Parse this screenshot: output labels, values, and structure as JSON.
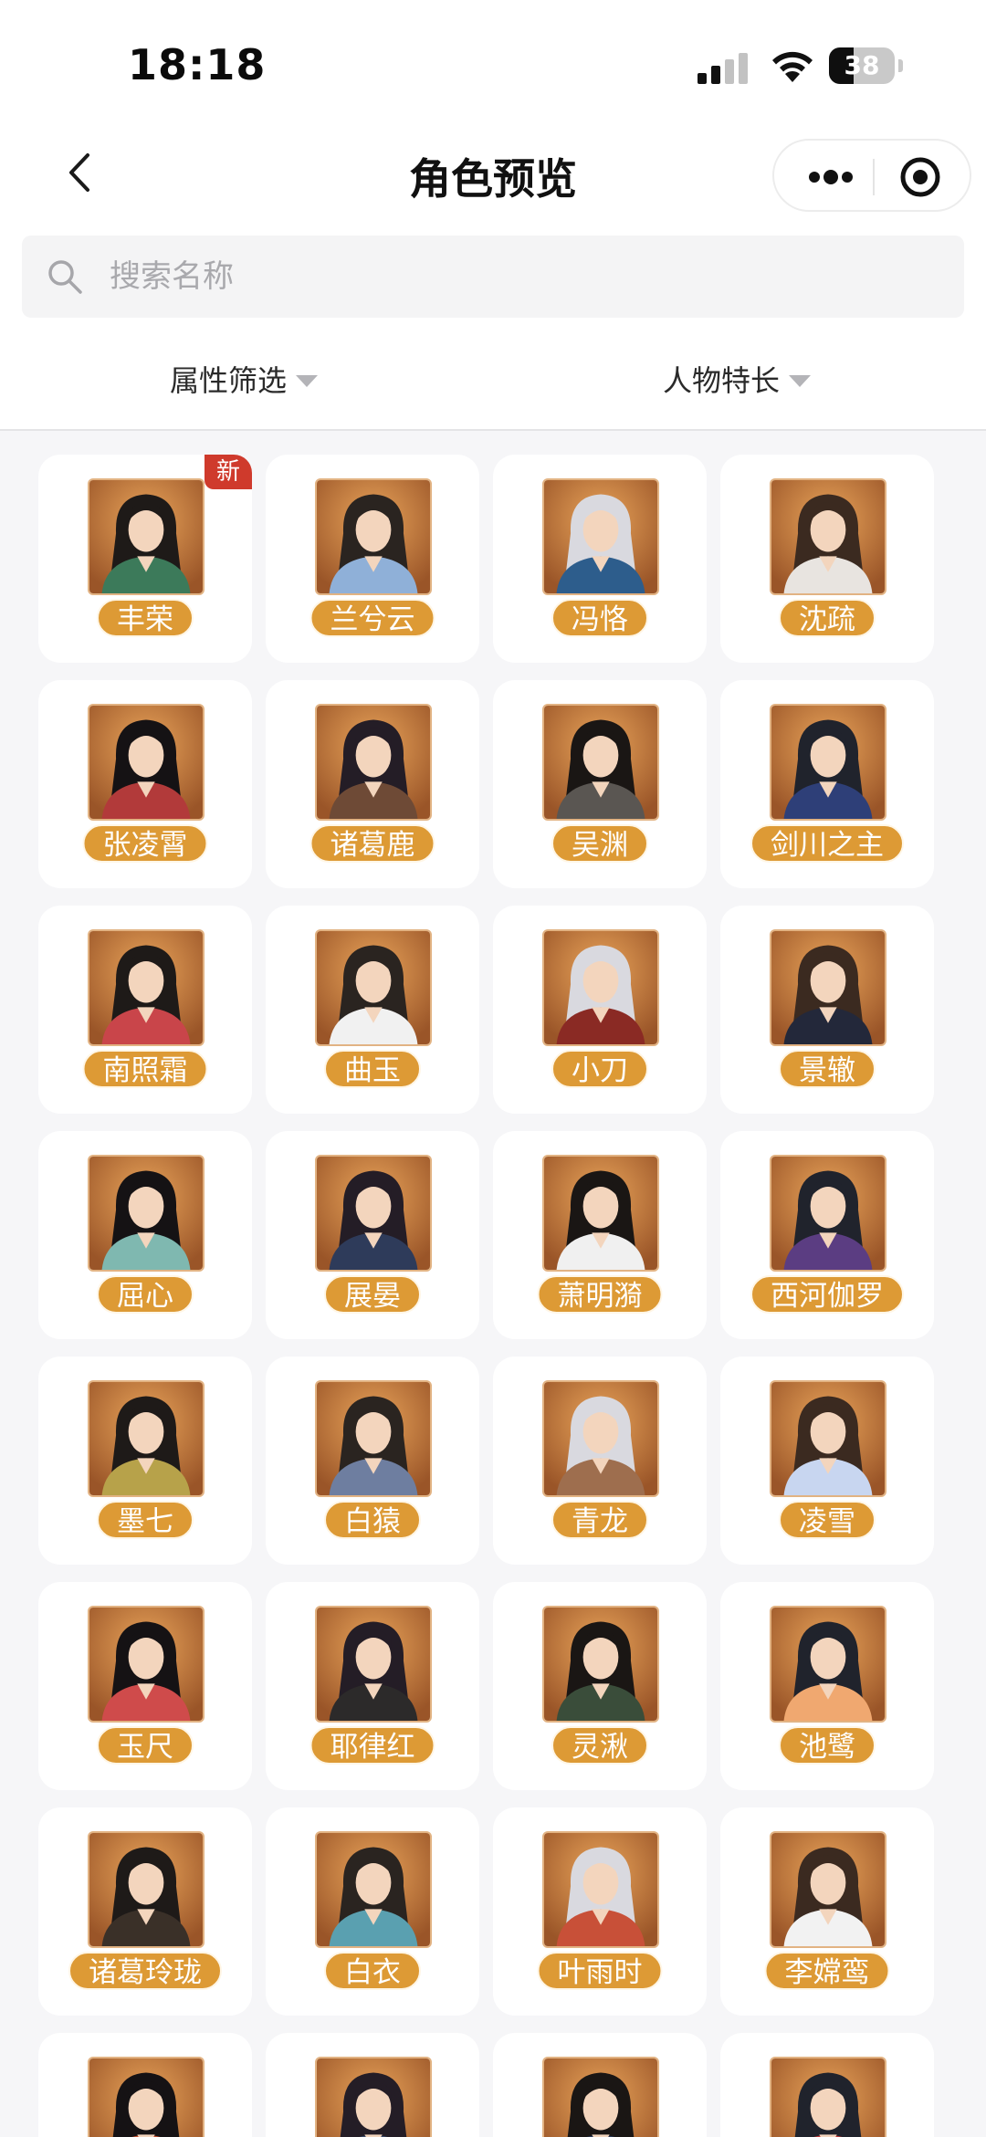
{
  "status_bar": {
    "time": "18:18",
    "battery": "38",
    "battery_level": 0.38
  },
  "header": {
    "title": "角色预览"
  },
  "search": {
    "placeholder": "搜索名称",
    "value": ""
  },
  "filters": [
    {
      "label": "属性筛选",
      "icon": "caret-down-icon"
    },
    {
      "label": "人物特长",
      "icon": "caret-down-icon"
    }
  ],
  "new_badge": "新",
  "colors": {
    "pill": "#dd9a35",
    "badge": "#cf3a2c",
    "avatar_bg": "#c97a3c"
  },
  "characters": [
    {
      "name": "丰荣",
      "is_new": true
    },
    {
      "name": "兰兮云"
    },
    {
      "name": "冯恪"
    },
    {
      "name": "沈疏"
    },
    {
      "name": "张凌霄"
    },
    {
      "name": "诸葛鹿"
    },
    {
      "name": "吴渊"
    },
    {
      "name": "剑川之主"
    },
    {
      "name": "南照霜"
    },
    {
      "name": "曲玉"
    },
    {
      "name": "小刀"
    },
    {
      "name": "景辙"
    },
    {
      "name": "屈心"
    },
    {
      "name": "展晏"
    },
    {
      "name": "萧明漪"
    },
    {
      "name": "西河伽罗"
    },
    {
      "name": "墨七"
    },
    {
      "name": "白猿"
    },
    {
      "name": "青龙"
    },
    {
      "name": "凌雪"
    },
    {
      "name": "玉尺"
    },
    {
      "name": "耶律红"
    },
    {
      "name": "灵湫"
    },
    {
      "name": "池鹭"
    },
    {
      "name": "诸葛玲珑"
    },
    {
      "name": "白衣"
    },
    {
      "name": "叶雨时"
    },
    {
      "name": "李嫦鸾"
    },
    {
      "name": ""
    },
    {
      "name": ""
    },
    {
      "name": ""
    },
    {
      "name": ""
    }
  ]
}
